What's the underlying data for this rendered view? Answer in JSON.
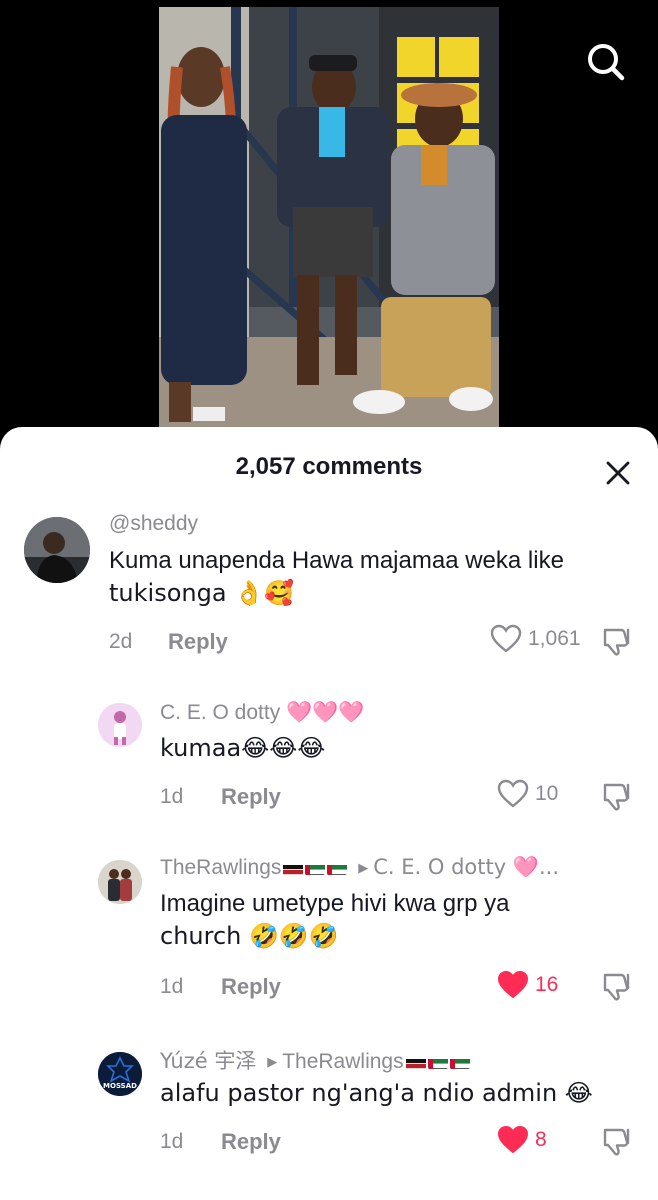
{
  "icons": {
    "search": "search-icon",
    "close": "close-icon",
    "heart": "heart-icon",
    "dislike": "thumbs-down-icon"
  },
  "colors": {
    "accent_like": "#fe2c55",
    "muted": "#8a8b91",
    "text": "#161823"
  },
  "sheet": {
    "title": "2,057 comments"
  },
  "comments": [
    {
      "username": "@sheddy",
      "text_line1": "Kuma unapenda Hawa majamaa weka like",
      "text_line2": "tukisonga 👌🥰",
      "time": "2d",
      "reply_label": "Reply",
      "likes": "1,061",
      "liked": false
    },
    {
      "username": "C. E. O dotty",
      "username_hearts": "🩷🩷🩷",
      "text_line1": "kumaa😂😂😂",
      "time": "1d",
      "reply_label": "Reply",
      "likes": "10",
      "liked": false
    },
    {
      "username": "TheRawlings",
      "reply_to": "C. E. O dotty 🩷...",
      "text_line1": "Imagine umetype hivi kwa grp ya",
      "text_line2": "church 🤣🤣🤣",
      "time": "1d",
      "reply_label": "Reply",
      "likes": "16",
      "liked": true
    },
    {
      "username": "Yúzé 宇泽",
      "reply_to": "TheRawlings",
      "avatar_text": "MOSSAD",
      "text_line1": "alafu pastor ng'ang'a ndio admin 😂",
      "time": "1d",
      "reply_label": "Reply",
      "likes": "8",
      "liked": true
    }
  ]
}
